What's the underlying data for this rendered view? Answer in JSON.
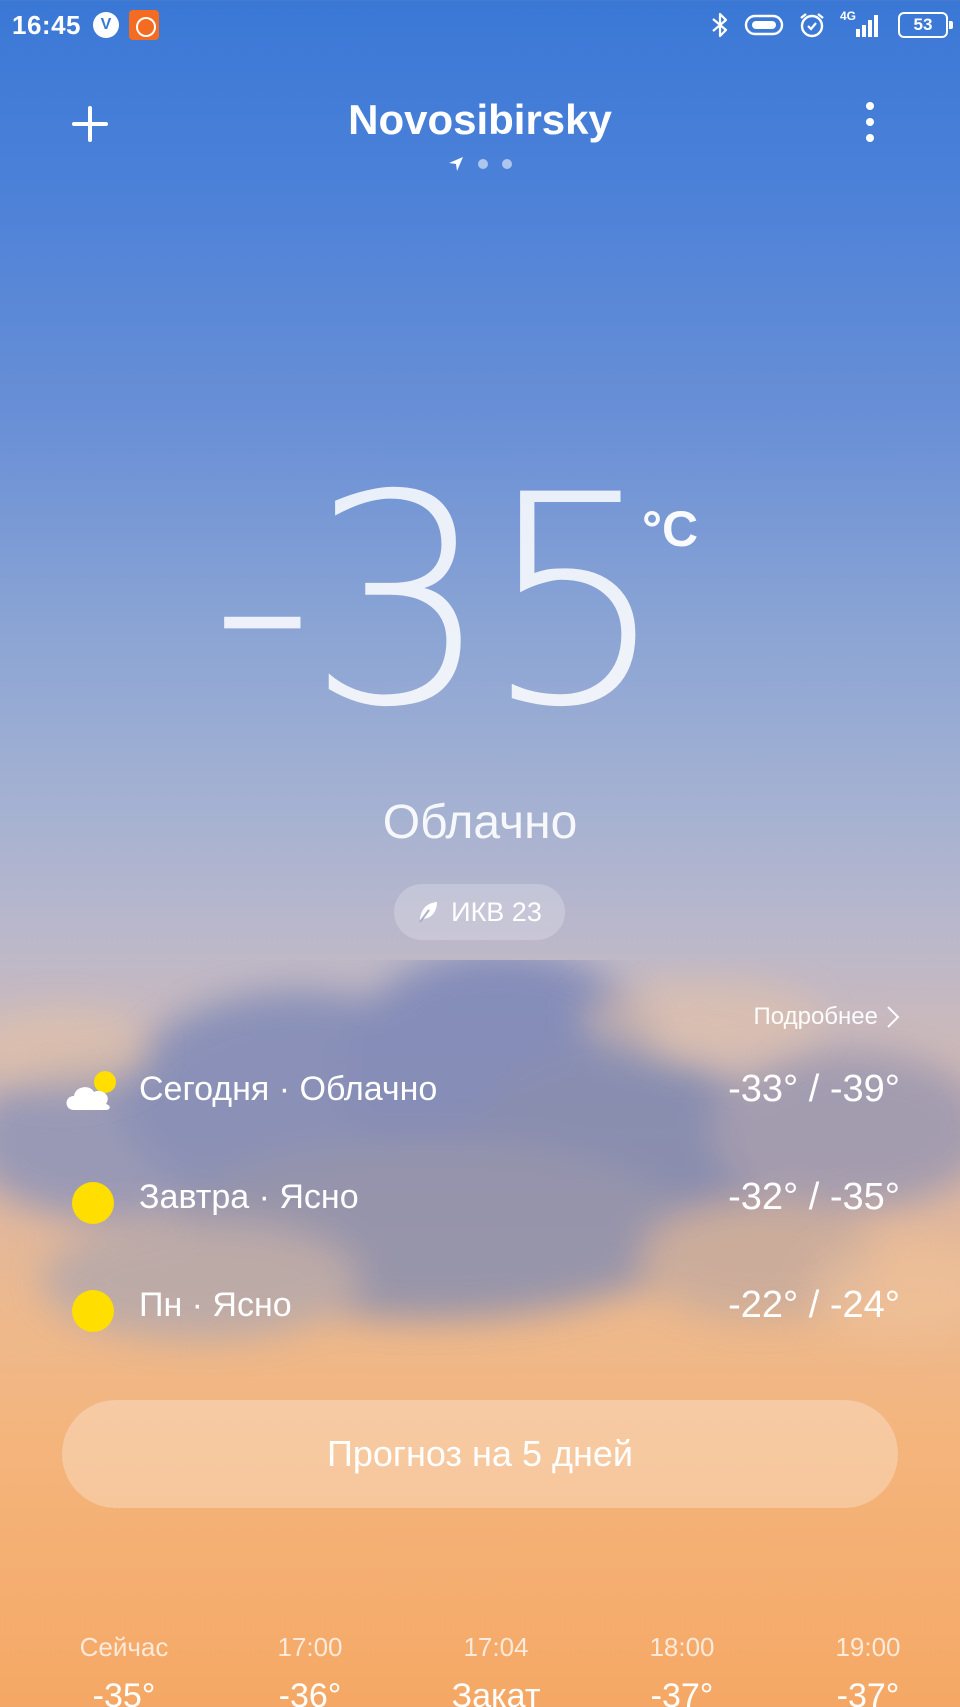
{
  "status_bar": {
    "time": "16:45",
    "vk_letter": "V",
    "signal_label": "4G",
    "battery": "53"
  },
  "header": {
    "city": "Novosibirsky"
  },
  "current": {
    "temperature": "-35",
    "unit": "°C",
    "condition": "Облачно",
    "aqi": "ИКВ 23"
  },
  "daily": {
    "details_label": "Подробнее",
    "rows": [
      {
        "label": "Сегодня · Облачно",
        "temps": "-33° / -39°",
        "icon": "partly-cloudy-icon"
      },
      {
        "label": "Завтра · Ясно",
        "temps": "-32° / -35°",
        "icon": "sun-icon"
      },
      {
        "label": "Пн · Ясно",
        "temps": "-22° / -24°",
        "icon": "sun-icon"
      }
    ]
  },
  "forecast_button": "Прогноз на 5 дней",
  "hourly": [
    {
      "time": "Сейчас",
      "value": "-35°"
    },
    {
      "time": "17:00",
      "value": "-36°"
    },
    {
      "time": "17:04",
      "value": "Закат"
    },
    {
      "time": "18:00",
      "value": "-37°"
    },
    {
      "time": "19:00",
      "value": "-37°"
    }
  ],
  "colors": {
    "sky_top": "#3a78d6",
    "sky_bottom": "#f5a865",
    "sun": "#ffde00"
  }
}
